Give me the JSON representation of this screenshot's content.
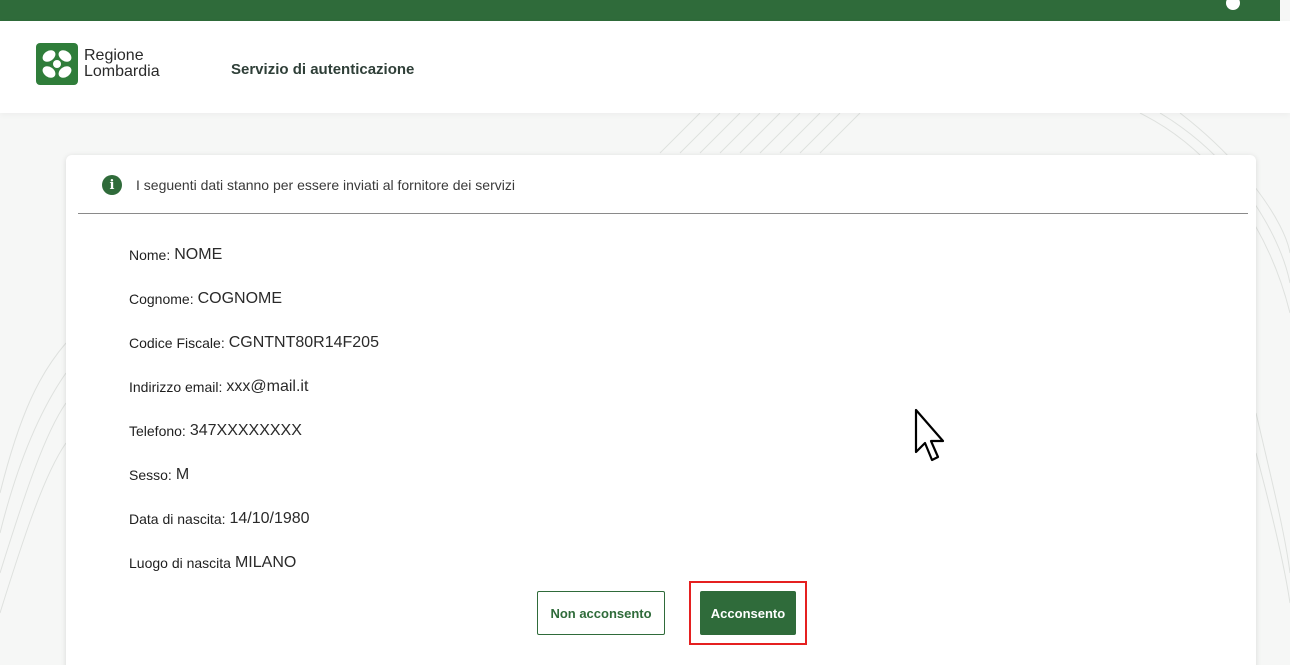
{
  "brand": {
    "logo_line1": "Regione",
    "logo_line2": "Lombardia",
    "color_primary": "#2f6b3a",
    "logo_icon": "regione-lombardia-logo-icon"
  },
  "header": {
    "service_title": "Servizio di autenticazione"
  },
  "notice": {
    "icon": "info-icon",
    "icon_glyph": "i",
    "text": "I seguenti dati stanno per essere inviati al fornitore dei servizi"
  },
  "fields": [
    {
      "label": "Nome:",
      "value": "NOME"
    },
    {
      "label": "Cognome:",
      "value": "COGNOME"
    },
    {
      "label": "Codice Fiscale:",
      "value": "CGNTNT80R14F205"
    },
    {
      "label": "Indirizzo email:",
      "value": "xxx@mail.it"
    },
    {
      "label": "Telefono:",
      "value": "347XXXXXXXX"
    },
    {
      "label": "Sesso:",
      "value": "M"
    },
    {
      "label": "Data di nascita:",
      "value": "14/10/1980"
    },
    {
      "label": "Luogo di nascita",
      "value": "MILANO"
    }
  ],
  "actions": {
    "decline_label": "Non acconsento",
    "accept_label": "Acconsento",
    "highlight_color": "#e52020"
  }
}
